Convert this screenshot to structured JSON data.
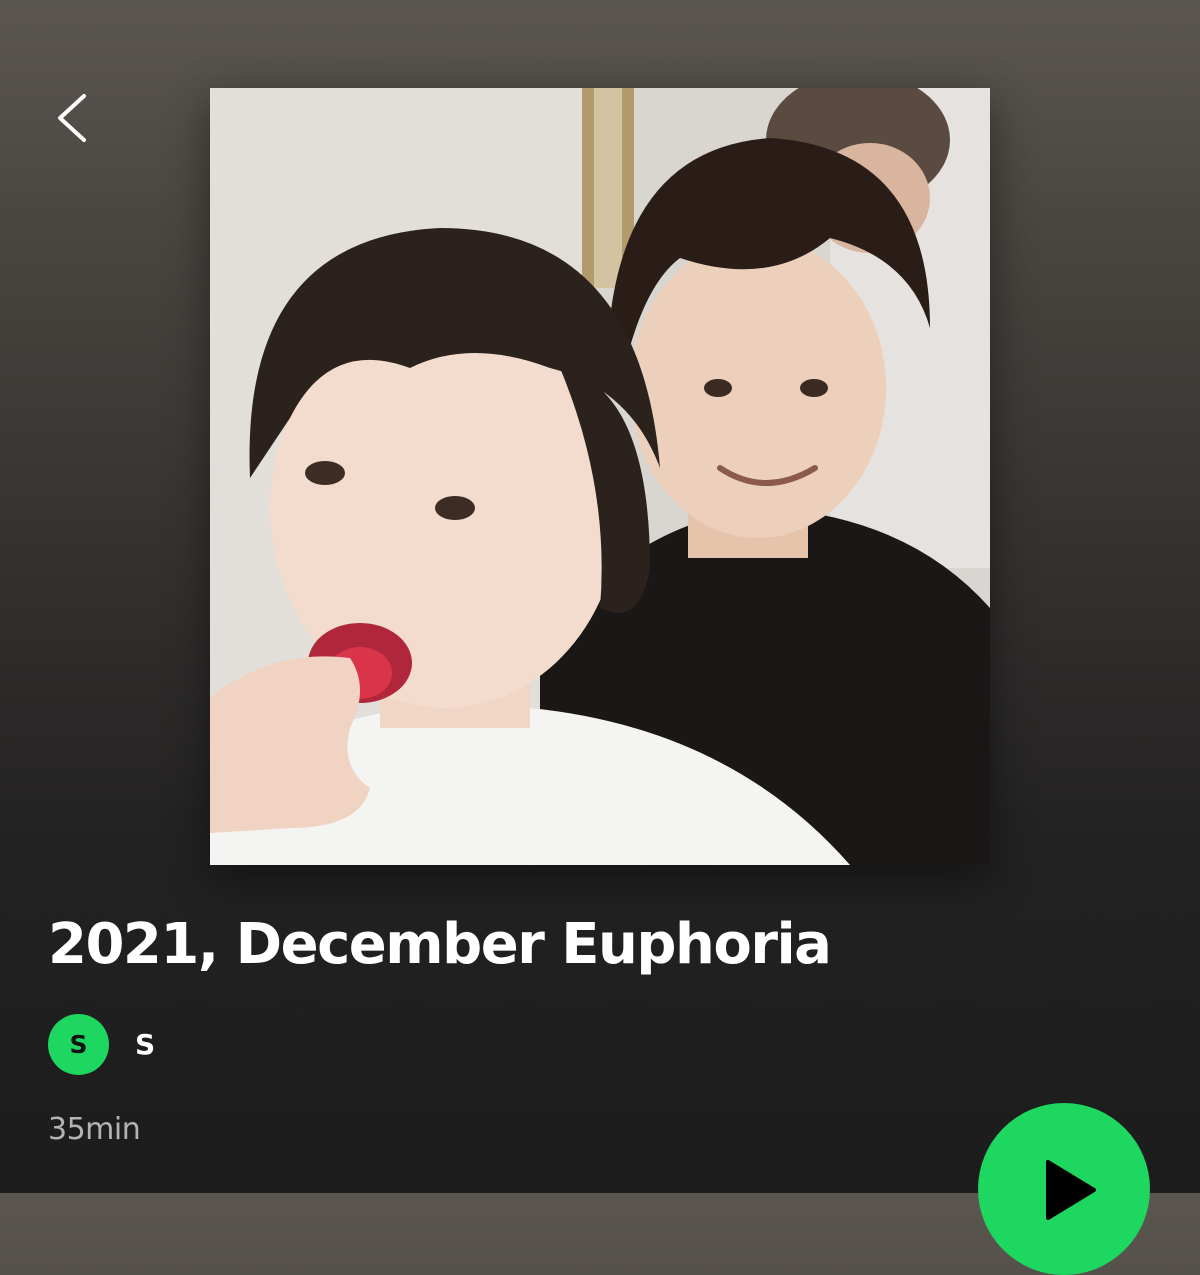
{
  "header": {
    "back_icon": "chevron-left-icon"
  },
  "playlist": {
    "cover_image": "photo of two people, one being fed a strawberry",
    "title": "2021, December Euphoria",
    "owner": {
      "avatar_letter": "S",
      "name": "S"
    },
    "duration": "35min"
  },
  "actions": {
    "play_icon": "play-icon"
  },
  "colors": {
    "accent": "#1ed760",
    "background_top": "#5b5650",
    "background_bottom": "#1c1c1c",
    "secondary_text": "#b3b3b3"
  }
}
